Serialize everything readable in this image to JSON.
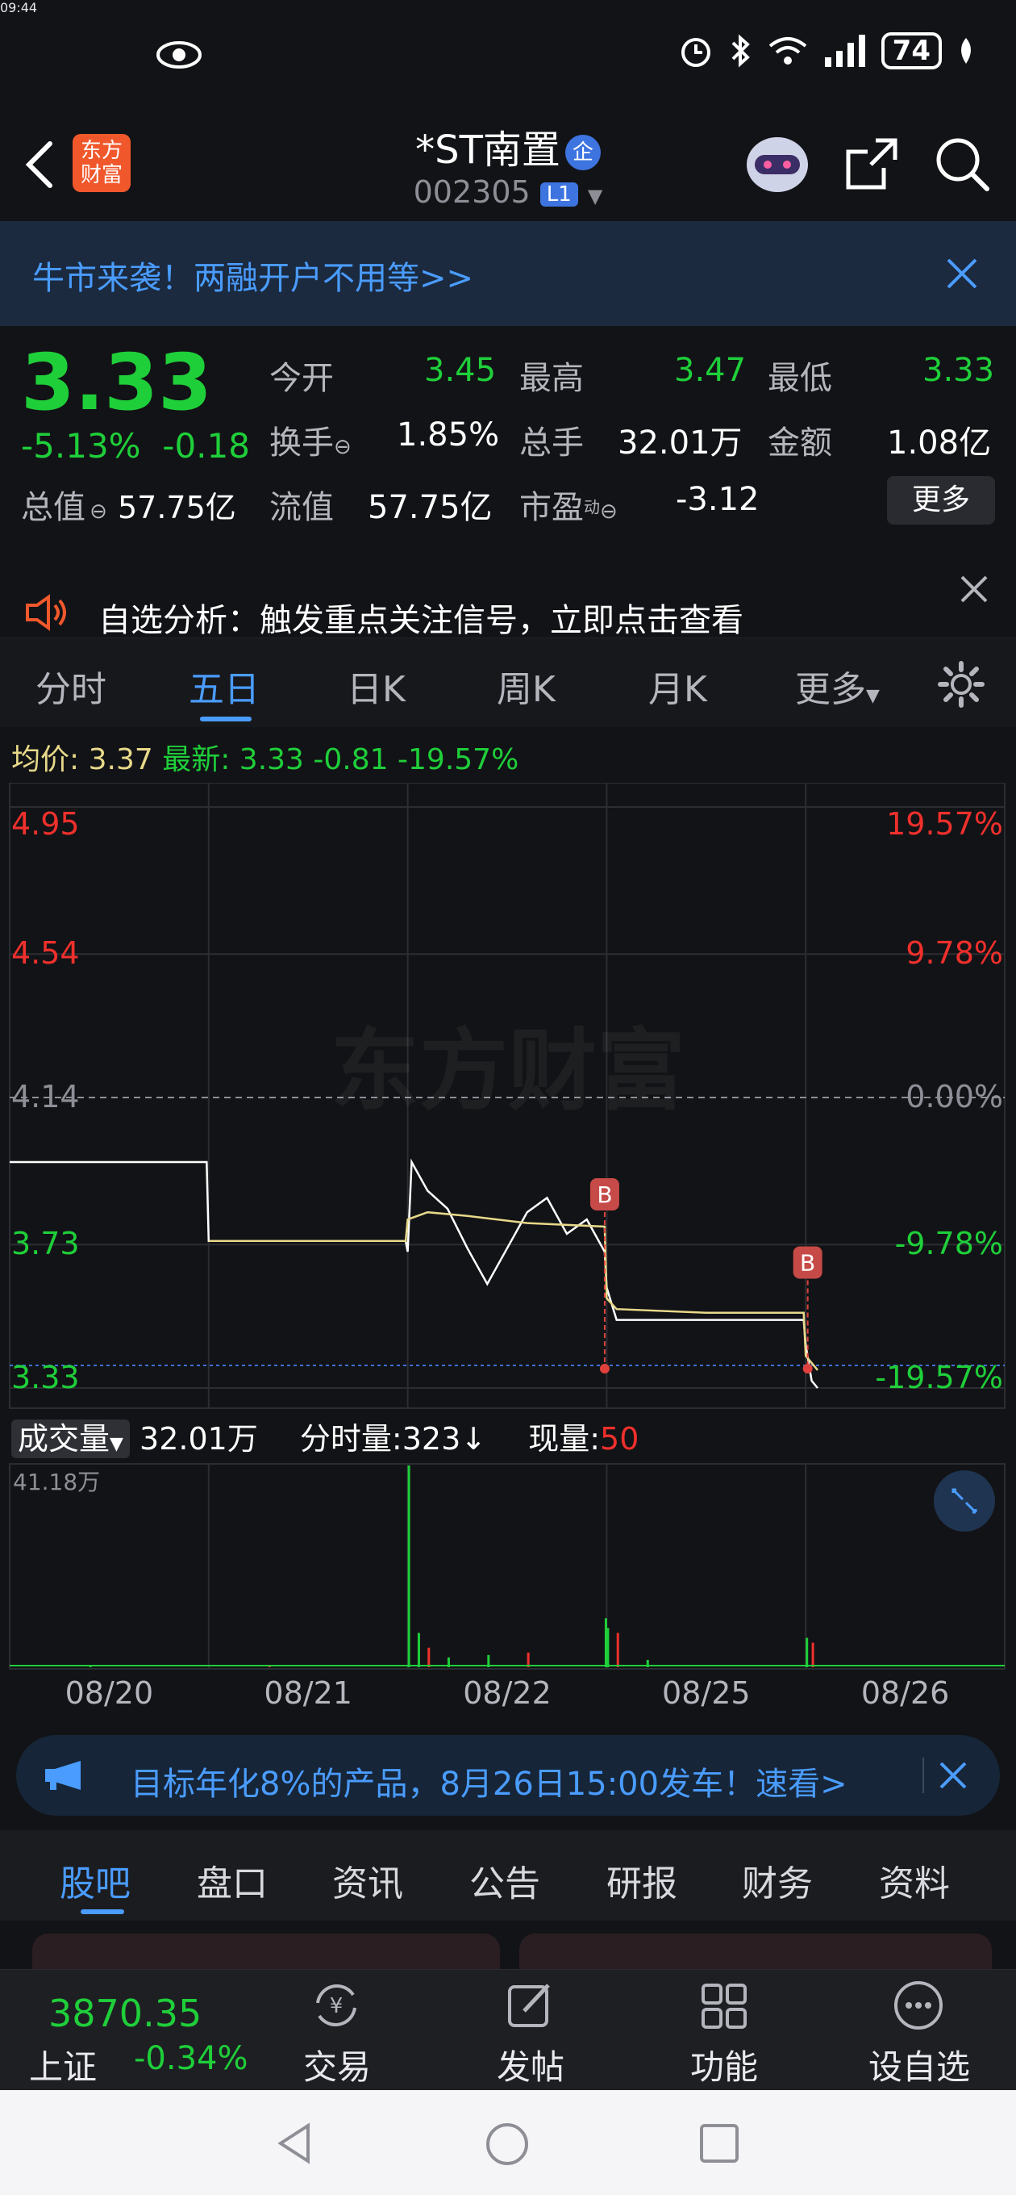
{
  "status_bar": {
    "time": "09:44",
    "battery": "74"
  },
  "header": {
    "logo_text": "东方财富",
    "stock_name": "*ST南置",
    "enterprise_badge": "企",
    "stock_code": "002305",
    "level_badge": "L1"
  },
  "banner": {
    "text": "牛市来袭！两融开户不用等>>"
  },
  "quote": {
    "price": "3.33",
    "change_pct": "-5.13%",
    "change_amt": "-0.18",
    "market_cap_label": "总值",
    "market_cap": "57.75亿",
    "stats": [
      {
        "label": "今开",
        "value": "3.45"
      },
      {
        "label": "最高",
        "value": "3.47"
      },
      {
        "label": "最低",
        "value": "3.33"
      },
      {
        "label": "换手",
        "value": "1.85%"
      },
      {
        "label": "总手",
        "value": "32.01万"
      },
      {
        "label": "金额",
        "value": "1.08亿"
      },
      {
        "label": "流值",
        "value": "57.75亿"
      },
      {
        "label": "市盈",
        "value": "-3.12"
      }
    ],
    "pe_superscript": "动",
    "more_label": "更多"
  },
  "alert": {
    "text": "自选分析：触发重点关注信号，立即点击查看"
  },
  "tabs": [
    "分时",
    "五日",
    "日K",
    "周K",
    "月K",
    "更多"
  ],
  "active_tab": "五日",
  "chart_header": {
    "avg_label": "均价:",
    "avg_value": "3.37",
    "latest_label": "最新:",
    "latest_value": "3.33",
    "latest_change": "-0.81",
    "latest_pct": "-19.57%"
  },
  "watermark": "东方财富",
  "volume_header": {
    "selector": "成交量",
    "total": "32.01万",
    "time_share_label": "分时量:",
    "time_share_value": "323↓",
    "current_label": "现量:",
    "current_value": "50",
    "max_label": "41.18万"
  },
  "marker_label": "B",
  "chart_data": {
    "type": "line",
    "title": "",
    "x_categories": [
      "08/20",
      "08/21",
      "08/22",
      "08/25",
      "08/26"
    ],
    "y_price_ticks": [
      "4.95",
      "4.54",
      "4.14",
      "3.73",
      "3.33"
    ],
    "y_pct_ticks": [
      "19.57%",
      "9.78%",
      "0.00%",
      "-9.78%",
      "-19.57%"
    ],
    "ylim": [
      3.33,
      4.95
    ],
    "reference_price": 4.14,
    "series": [
      {
        "name": "",
        "color": "#ffffff",
        "points": [
          [
            0,
            3.96
          ],
          [
            0.99,
            3.96
          ],
          [
            1,
            3.74
          ],
          [
            1.99,
            3.74
          ],
          [
            2.0,
            3.71
          ],
          [
            2.02,
            3.96
          ],
          [
            2.1,
            3.88
          ],
          [
            2.2,
            3.83
          ],
          [
            2.3,
            3.72
          ],
          [
            2.4,
            3.62
          ],
          [
            2.5,
            3.72
          ],
          [
            2.6,
            3.82
          ],
          [
            2.7,
            3.86
          ],
          [
            2.8,
            3.76
          ],
          [
            2.9,
            3.8
          ],
          [
            2.99,
            3.71
          ],
          [
            3.0,
            3.61
          ],
          [
            3.05,
            3.52
          ],
          [
            3.2,
            3.52
          ],
          [
            3.99,
            3.52
          ],
          [
            4.0,
            3.45
          ],
          [
            4.03,
            3.35
          ],
          [
            4.06,
            3.33
          ]
        ]
      },
      {
        "name": "",
        "color": "#e8d98a",
        "points": [
          [
            1,
            3.74
          ],
          [
            1.99,
            3.74
          ],
          [
            2.0,
            3.8
          ],
          [
            2.1,
            3.82
          ],
          [
            2.3,
            3.81
          ],
          [
            2.6,
            3.79
          ],
          [
            2.99,
            3.78
          ],
          [
            3.0,
            3.58
          ],
          [
            3.05,
            3.55
          ],
          [
            3.5,
            3.54
          ],
          [
            3.99,
            3.54
          ],
          [
            4.0,
            3.42
          ],
          [
            4.06,
            3.38
          ]
        ]
      }
    ],
    "markers": [
      {
        "x": 2.99,
        "price": 3.78,
        "type": "B"
      },
      {
        "x": 4.01,
        "price": 3.59,
        "type": "B"
      }
    ],
    "volume": {
      "ylim": [
        0,
        41.18
      ],
      "unit": "万",
      "bars": [
        [
          0.4,
          0.4
        ],
        [
          1.3,
          0.3
        ],
        [
          2.0,
          41.18
        ],
        [
          2.05,
          7
        ],
        [
          2.1,
          4
        ],
        [
          2.2,
          2
        ],
        [
          2.4,
          2.5
        ],
        [
          2.6,
          3
        ],
        [
          2.99,
          10
        ],
        [
          3.0,
          8
        ],
        [
          3.05,
          7
        ],
        [
          3.2,
          1.5
        ],
        [
          4.0,
          6
        ],
        [
          4.03,
          5
        ]
      ]
    }
  },
  "ad": {
    "text": "目标年化8%的产品，8月26日15:00发车！速看>"
  },
  "bottom_tabs": [
    "股吧",
    "盘口",
    "资讯",
    "公告",
    "研报",
    "财务",
    "资料"
  ],
  "active_bottom_tab": "股吧",
  "index": {
    "value": "3870.35",
    "name": "上证",
    "change": "-0.34%"
  },
  "nav": [
    "交易",
    "发帖",
    "功能",
    "设自选"
  ]
}
